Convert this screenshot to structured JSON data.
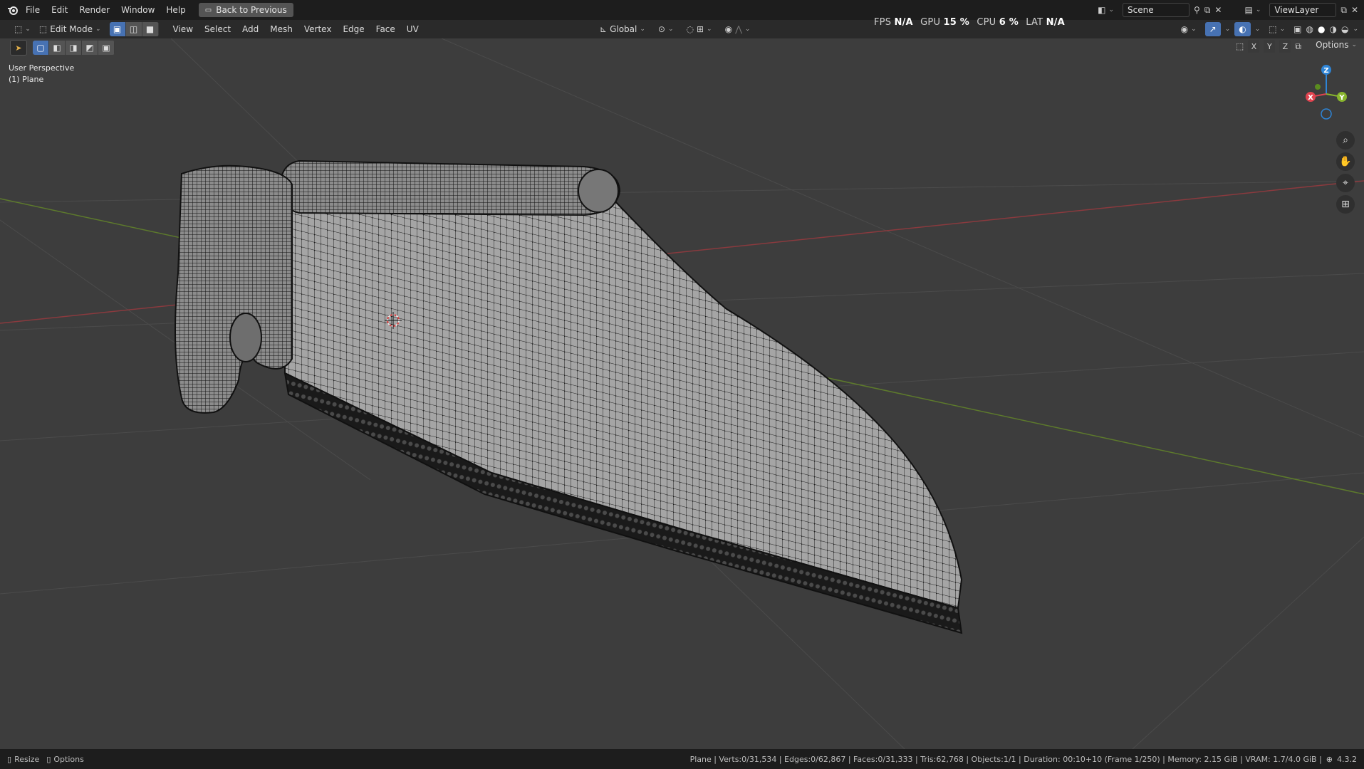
{
  "topbar": {
    "menus": [
      "File",
      "Edit",
      "Render",
      "Window",
      "Help"
    ],
    "back_button": "Back to Previous",
    "scene_name": "Scene",
    "view_layer": "ViewLayer"
  },
  "header": {
    "mode": "Edit Mode",
    "menus": [
      "View",
      "Select",
      "Add",
      "Mesh",
      "Vertex",
      "Edge",
      "Face",
      "UV"
    ],
    "orientation": "Global"
  },
  "perf": {
    "fps_label": "FPS",
    "fps_value": "N/A",
    "gpu_label": "GPU",
    "gpu_value": "15 %",
    "cpu_label": "CPU",
    "cpu_value": "6 %",
    "lat_label": "LAT",
    "lat_value": "N/A"
  },
  "viewport": {
    "view_name": "User Perspective",
    "object_label": "(1) Plane",
    "axes": [
      "X",
      "Y",
      "Z"
    ],
    "options_label": "Options",
    "gizmo": {
      "z": "Z",
      "y": "Y",
      "x": "X"
    }
  },
  "statusbar": {
    "left": [
      "Resize",
      "Options"
    ],
    "stats": "Plane | Verts:0/31,534 | Edges:0/62,867 | Faces:0/31,333 | Tris:62,768 | Objects:1/1 | Duration: 00:10+10 (Frame 1/250) | Memory: 2.15 GiB | VRAM: 1.7/4.0 GiB |",
    "version": "4.3.2"
  },
  "colors": {
    "topbar_bg": "#1d1d1d",
    "header_bg": "#2a2a2a",
    "viewport_bg": "#3d3d3d",
    "accent": "#4772b3",
    "axis_x": "#e0434f",
    "axis_y": "#88b52d",
    "axis_z": "#2e84d6"
  },
  "icons": [
    "blender-logo-icon",
    "editor-type-icon",
    "vertex-select-icon",
    "edge-select-icon",
    "face-select-icon",
    "pivot-icon",
    "snap-icon",
    "proportional-icon",
    "zoom-icon",
    "hand-pan-icon",
    "camera-icon",
    "grid-icon"
  ]
}
